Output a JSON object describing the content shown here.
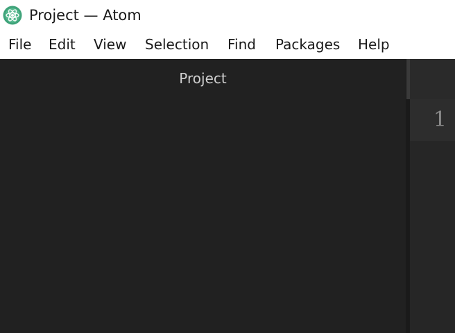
{
  "window": {
    "title": "Project — Atom",
    "app_icon": "atom-icon"
  },
  "menu": {
    "items": [
      {
        "label": "File"
      },
      {
        "label": "Edit"
      },
      {
        "label": "View"
      },
      {
        "label": "Selection"
      },
      {
        "label": "Find"
      },
      {
        "label": "Packages"
      },
      {
        "label": "Help"
      }
    ]
  },
  "tree_view": {
    "header": "Project"
  },
  "editor": {
    "line_numbers": [
      "1"
    ]
  },
  "colors": {
    "icon_green": "#3fa37a",
    "panel_background": "#212121",
    "editor_background": "#262626"
  }
}
